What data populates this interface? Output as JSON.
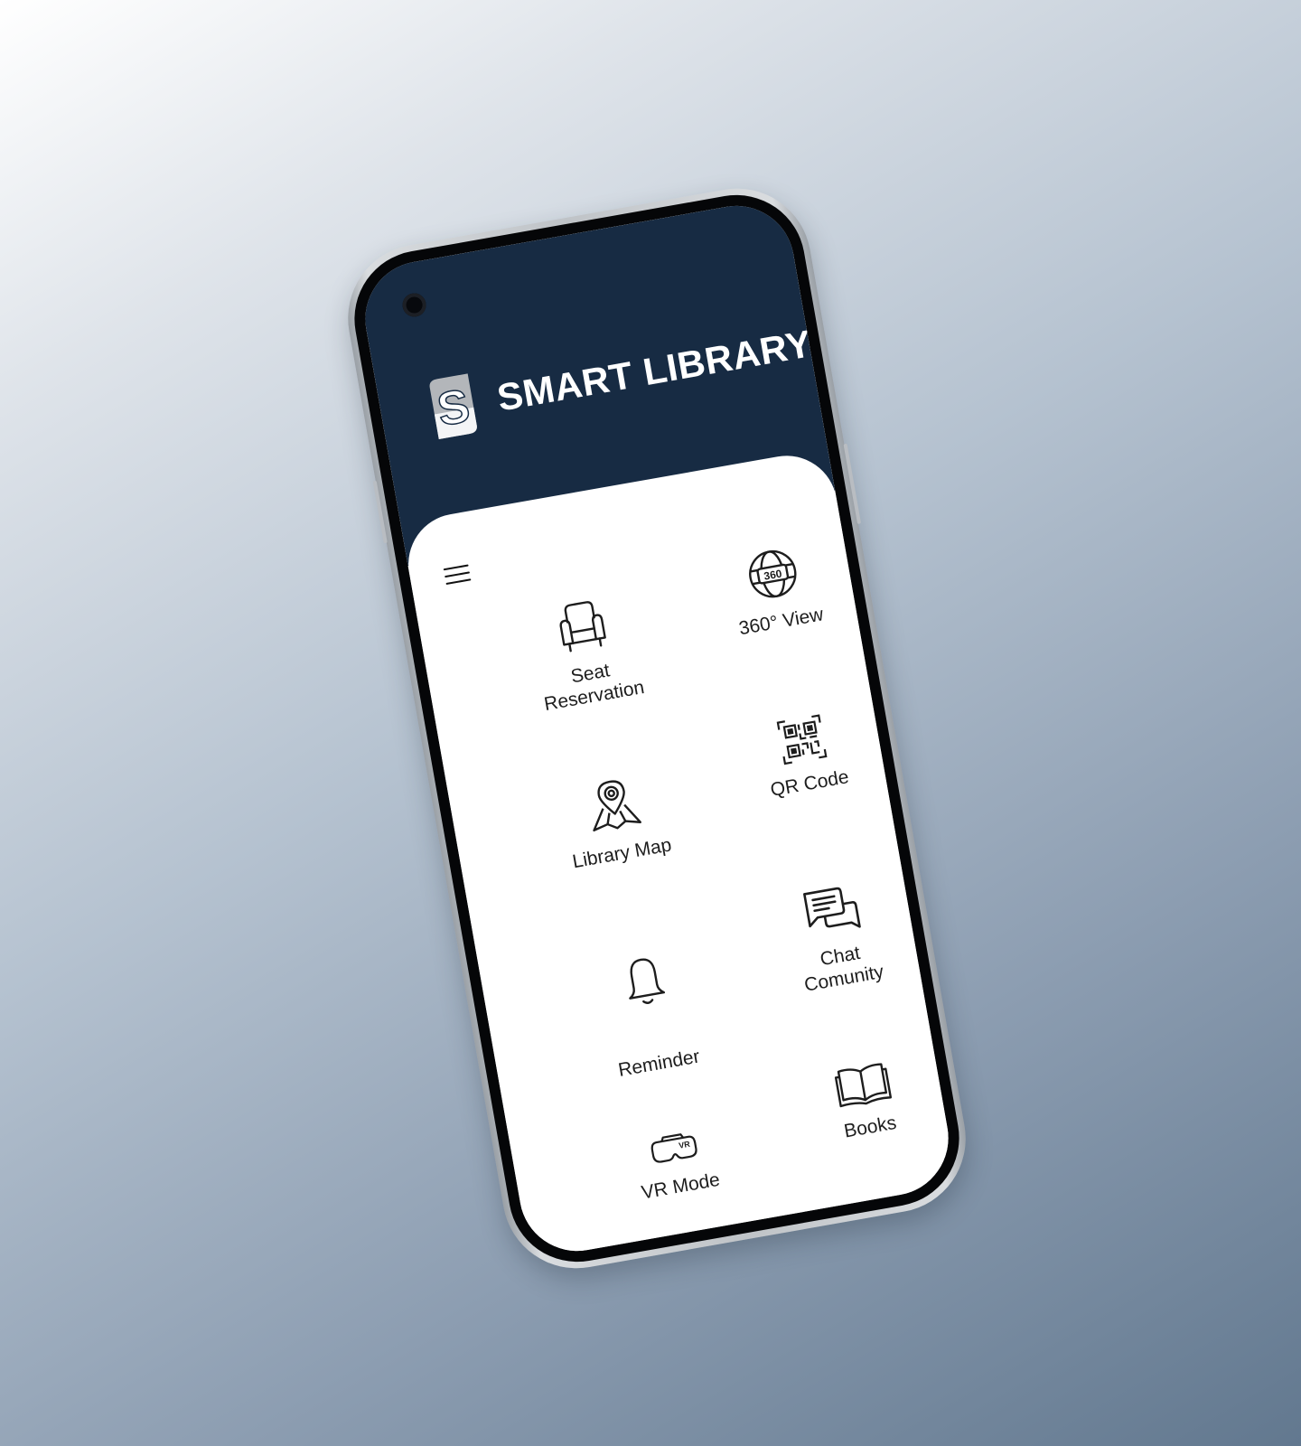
{
  "app": {
    "title": "SMART LIBRARY",
    "logo_letter": "S"
  },
  "colors": {
    "header": "#172b43",
    "sheet": "#ffffff",
    "icon_stroke": "#1d1d1d"
  },
  "features": [
    {
      "label": "Seat\nReservation",
      "icon": "armchair-icon"
    },
    {
      "label": "360°  View",
      "icon": "globe-360-icon"
    },
    {
      "label": "Library Map",
      "icon": "map-pin-icon"
    },
    {
      "label": "QR Code",
      "icon": "qr-code-icon"
    },
    {
      "label": "Reminder",
      "icon": "bell-icon"
    },
    {
      "label": "Chat\nComunity",
      "icon": "chat-bubbles-icon"
    },
    {
      "label": "VR Mode",
      "icon": "vr-headset-icon",
      "icon_text": "VR"
    },
    {
      "label": "Books",
      "icon": "open-book-icon"
    }
  ]
}
